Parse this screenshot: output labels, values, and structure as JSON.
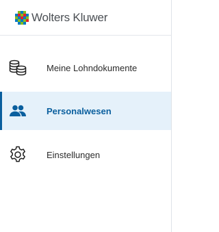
{
  "brand": {
    "name": "Wolters Kluwer",
    "logo_icon": "wolters-kluwer-logo-mark"
  },
  "colors": {
    "accent": "#0a5f9e",
    "active_background": "#e5f1fa",
    "text": "#2b2b2b"
  },
  "nav": {
    "items": [
      {
        "label": "Meine Lohndokumente",
        "icon": "coins-stack-icon",
        "active": false
      },
      {
        "label": "Personalwesen",
        "icon": "people-icon",
        "active": true
      },
      {
        "label": "Einstellungen",
        "icon": "gear-icon",
        "active": false
      }
    ]
  }
}
